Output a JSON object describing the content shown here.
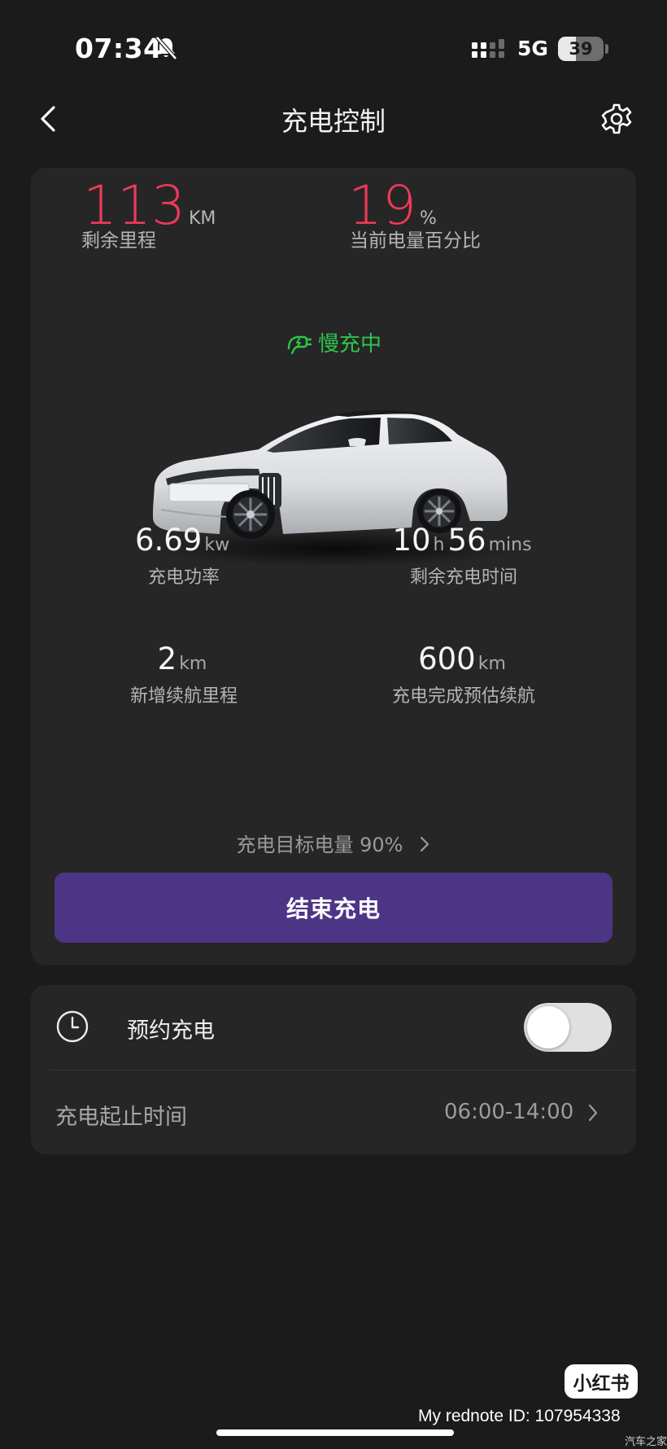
{
  "status_bar": {
    "time": "07:34",
    "network": "5G",
    "battery_level": "39",
    "battery_fraction": 0.39
  },
  "header": {
    "title": "充电控制",
    "back_icon": "chevron-left-icon",
    "settings_icon": "gear-icon"
  },
  "summary": {
    "range_value": "113",
    "range_unit": "KM",
    "range_label": "剩余里程",
    "soc_value": "19",
    "soc_unit": "%",
    "soc_label": "当前电量百分比"
  },
  "charge_state": {
    "text": "慢充中",
    "icon": "plug-icon",
    "color": "#2ec54a"
  },
  "metrics": {
    "power_value": "6.69",
    "power_unit": "kw",
    "power_label": "充电功率",
    "remaining_hours": "10",
    "remaining_hours_unit": "h",
    "remaining_minutes": "56",
    "remaining_minutes_unit": "mins",
    "remaining_label": "剩余充电时间",
    "added_range_value": "2",
    "added_range_unit": "km",
    "added_range_label": "新增续航里程",
    "estimated_range_value": "600",
    "estimated_range_unit": "km",
    "estimated_range_label": "充电完成预估续航"
  },
  "target": {
    "label": "充电目标电量 90%"
  },
  "actions": {
    "end_charging": "结束充电"
  },
  "schedule": {
    "label": "预约充电",
    "toggle_on": false,
    "time_range_label": "充电起止时间",
    "time_range_value": "06:00-14:00"
  },
  "watermark": {
    "badge": "小红书",
    "id_text": "My rednote ID: 107954338",
    "site": "汽车之家"
  },
  "colors": {
    "accent_red": "#ee3a57",
    "button_purple": "#4d3586",
    "background": "#1b1b1c",
    "card": "#262627"
  }
}
